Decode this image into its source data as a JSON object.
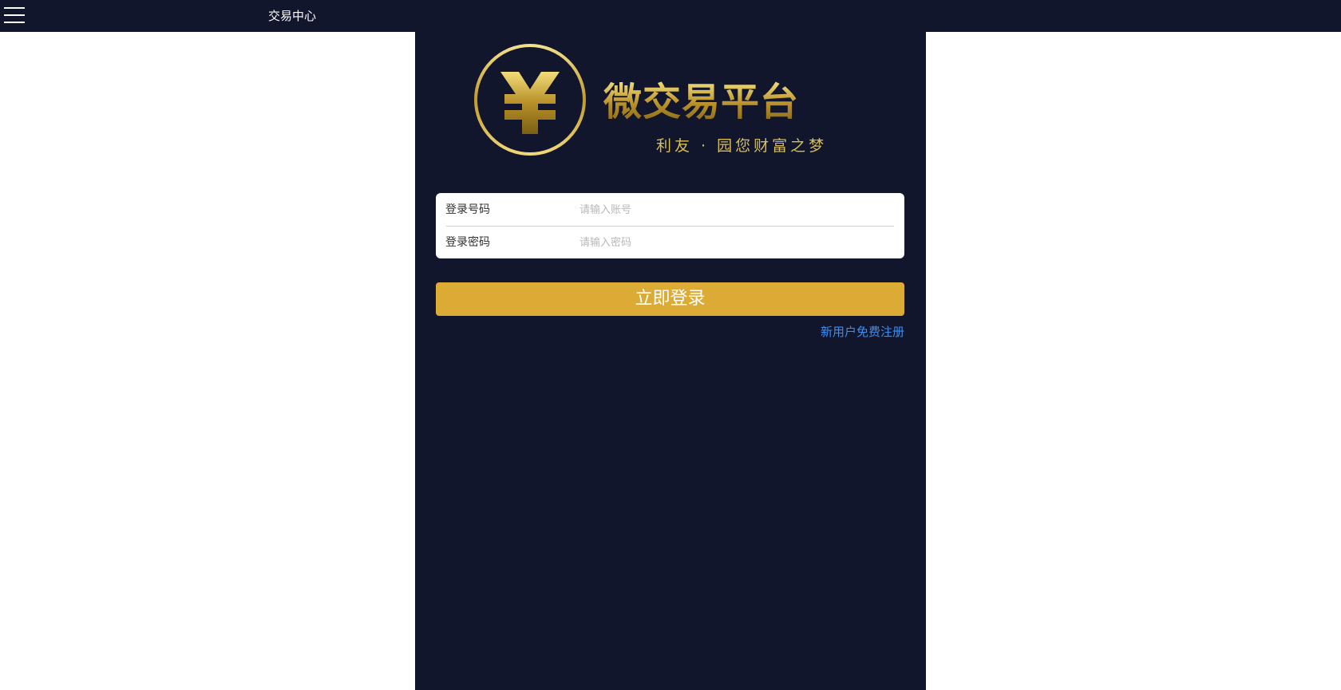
{
  "header": {
    "title": "交易中心",
    "menu_icon": "hamburger-menu-icon"
  },
  "logo": {
    "symbol": "¥",
    "name": "微交易平台",
    "slogan": "利友 · 园您财富之梦"
  },
  "form": {
    "account_label": "登录号码",
    "account_placeholder": "请输入账号",
    "password_label": "登录密码",
    "password_placeholder": "请输入密码"
  },
  "actions": {
    "login_label": "立即登录",
    "register_label": "新用户免费注册"
  },
  "colors": {
    "background": "#12162c",
    "accent": "#dcab35",
    "link": "#3d8ef0",
    "logo_gold": "#c9a72f"
  }
}
